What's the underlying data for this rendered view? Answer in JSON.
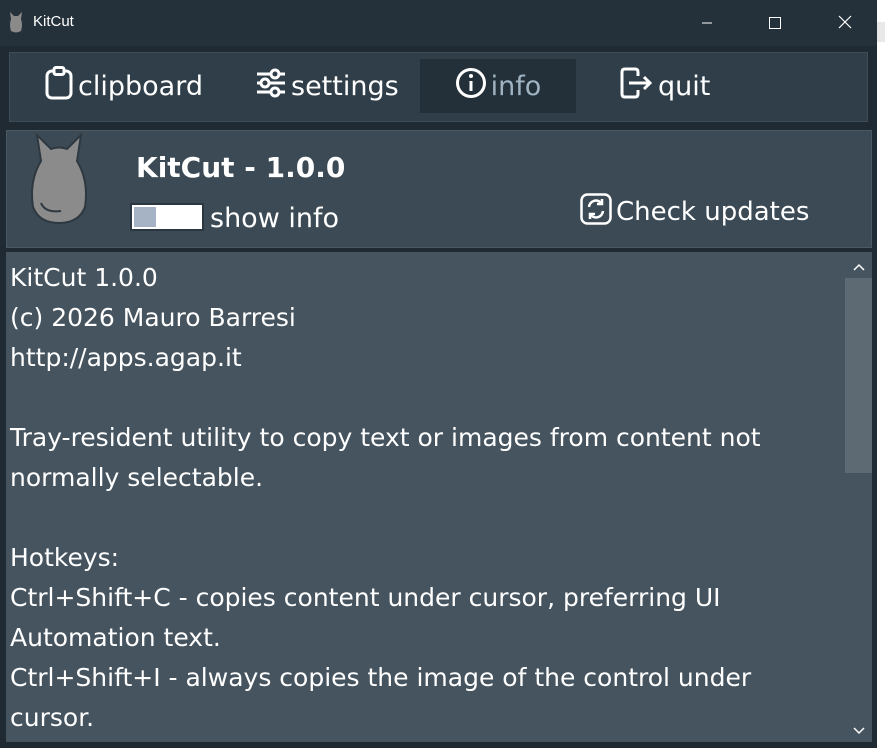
{
  "window": {
    "title": "KitCut",
    "app_icon": "cat-icon",
    "controls": [
      "minimize-icon",
      "maximize-icon",
      "close-icon"
    ]
  },
  "nav": {
    "items": [
      {
        "label": "clipboard",
        "icon": "clipboard-icon"
      },
      {
        "label": "settings",
        "icon": "sliders-icon"
      },
      {
        "label": "info",
        "icon": "info-icon",
        "active": true
      },
      {
        "label": "quit",
        "icon": "exit-icon"
      }
    ]
  },
  "header": {
    "app_name": "KitCut - 1.0.0",
    "toggle_label": "show info",
    "check_updates_label": "Check updates"
  },
  "info_text": "KitCut 1.0.0\n(c) 2026 Mauro Barresi\nhttp://apps.agap.it\n\nTray-resident utility to copy text or images from content not normally selectable.\n\nHotkeys:\nCtrl+Shift+C - copies content under cursor, preferring UI Automation text.\nCtrl+Shift+I - always copies the image of the control under cursor.",
  "colors": {
    "background": "#1f2a33",
    "nav_active_text": "#9fb3c3",
    "content_bg": "#46545f"
  }
}
